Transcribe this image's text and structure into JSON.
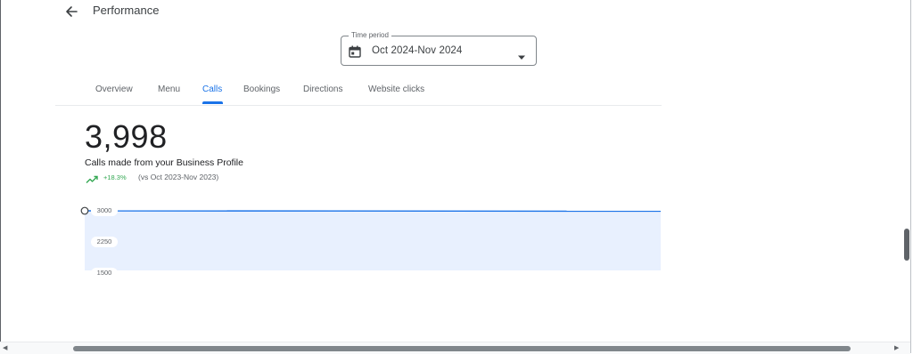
{
  "header": {
    "title": "Performance",
    "back_icon": "back-arrow-icon"
  },
  "time_period": {
    "label": "Time period",
    "value": "Oct 2024-Nov 2024",
    "calendar_icon": "calendar-icon",
    "dropdown_icon": "caret-down-icon"
  },
  "tabs": [
    {
      "label": "Overview",
      "active": false
    },
    {
      "label": "Menu",
      "active": false
    },
    {
      "label": "Calls",
      "active": true
    },
    {
      "label": "Bookings",
      "active": false
    },
    {
      "label": "Directions",
      "active": false
    },
    {
      "label": "Website clicks",
      "active": false
    }
  ],
  "metric": {
    "value": "3,998",
    "label": "Calls made from your Business Profile",
    "trend_icon": "trending-up-icon",
    "trend_percent": "+18.3%",
    "comparison": "(vs Oct 2023-Nov 2023)"
  },
  "colors": {
    "accent": "#1a73e8",
    "chart_fill": "#e8f0fe",
    "trend_positive": "#34a853"
  },
  "chart_data": {
    "type": "area",
    "x": [
      0,
      1
    ],
    "series": [
      {
        "values": [
          3000,
          2990
        ]
      }
    ],
    "y_ticks": [
      "3000",
      "2250",
      "1500"
    ],
    "ylim": [
      1500,
      3000
    ],
    "grid": false
  }
}
